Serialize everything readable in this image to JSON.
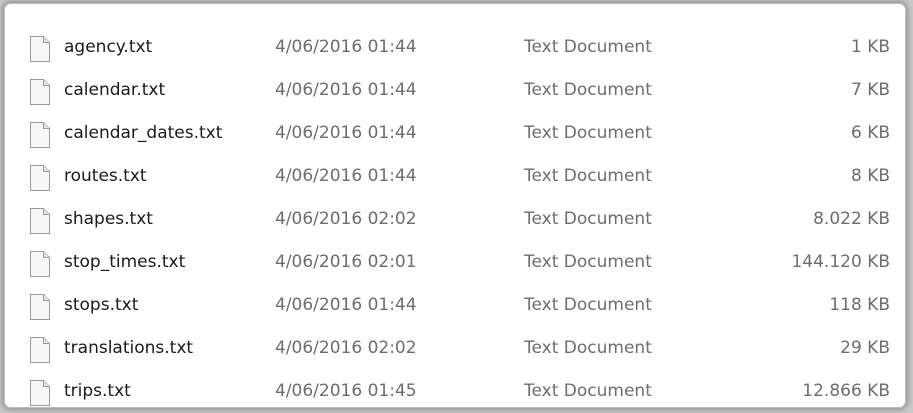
{
  "files": [
    {
      "name": "agency.txt",
      "date": "4/06/2016 01:44",
      "type": "Text Document",
      "size": "1 KB",
      "icon": "text-file-icon"
    },
    {
      "name": "calendar.txt",
      "date": "4/06/2016 01:44",
      "type": "Text Document",
      "size": "7 KB",
      "icon": "text-file-icon"
    },
    {
      "name": "calendar_dates.txt",
      "date": "4/06/2016 01:44",
      "type": "Text Document",
      "size": "6 KB",
      "icon": "text-file-icon"
    },
    {
      "name": "routes.txt",
      "date": "4/06/2016 01:44",
      "type": "Text Document",
      "size": "8 KB",
      "icon": "text-file-icon"
    },
    {
      "name": "shapes.txt",
      "date": "4/06/2016 02:02",
      "type": "Text Document",
      "size": "8.022 KB",
      "icon": "text-file-icon"
    },
    {
      "name": "stop_times.txt",
      "date": "4/06/2016 02:01",
      "type": "Text Document",
      "size": "144.120 KB",
      "icon": "text-file-icon"
    },
    {
      "name": "stops.txt",
      "date": "4/06/2016 01:44",
      "type": "Text Document",
      "size": "118 KB",
      "icon": "text-file-icon"
    },
    {
      "name": "translations.txt",
      "date": "4/06/2016 02:02",
      "type": "Text Document",
      "size": "29 KB",
      "icon": "text-file-icon"
    },
    {
      "name": "trips.txt",
      "date": "4/06/2016 01:45",
      "type": "Text Document",
      "size": "12.866 KB",
      "icon": "text-file-icon"
    }
  ],
  "colors": {
    "name_text": "#1a1a1a",
    "detail_text": "#6d6d6d",
    "background": "#ffffff"
  }
}
